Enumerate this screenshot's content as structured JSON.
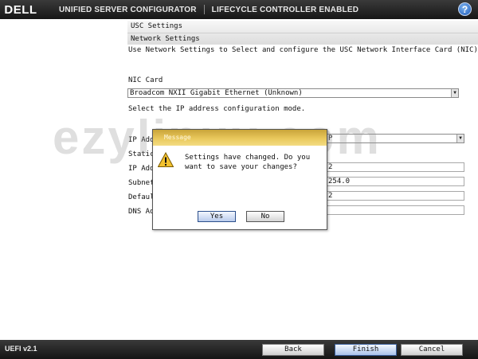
{
  "header": {
    "logo": "DELL",
    "title": "UNIFIED SERVER CONFIGURATOR",
    "subtitle": "LIFECYCLE CONTROLLER ENABLED",
    "help_icon": "help-icon",
    "help_glyph": "?"
  },
  "breadcrumb": {
    "level1": "USC Settings",
    "level2": "Network Settings"
  },
  "content": {
    "description": "Use Network Settings to Select and configure the USC Network Interface Card (NIC).",
    "nic_label": "NIC Card",
    "nic_value": "Broadcom NXII Gigabit Ethernet (Unknown)",
    "mode_instruction": "Select the IP address configuration mode.",
    "ip_mode_label_partial": "IP Addr",
    "ip_mode_value_partial": "P",
    "static_label_partial": "Static",
    "ip_label_partial": "IP Addr",
    "ip_value_partial": "2",
    "subnet_label_partial": "Subnet",
    "subnet_value_partial": "254.0",
    "gateway_label_partial": "Default",
    "gateway_value_partial": "2",
    "dns_label_partial": "DNS Add",
    "dns_value_partial": ""
  },
  "watermark": "ezylinux.com",
  "dialog": {
    "title": "Message",
    "icon": "warning-icon",
    "message": "Settings have changed. Do you want to save your changes?",
    "yes_label": "Yes",
    "no_label": "No"
  },
  "footer": {
    "version": "UEFI v2.1",
    "back_label": "Back",
    "finish_label": "Finish",
    "cancel_label": "Cancel"
  },
  "colors": {
    "header_bg": "#1c1c1c",
    "dialog_title": "#e0bb4c",
    "primary_button": "#b9cbec"
  }
}
